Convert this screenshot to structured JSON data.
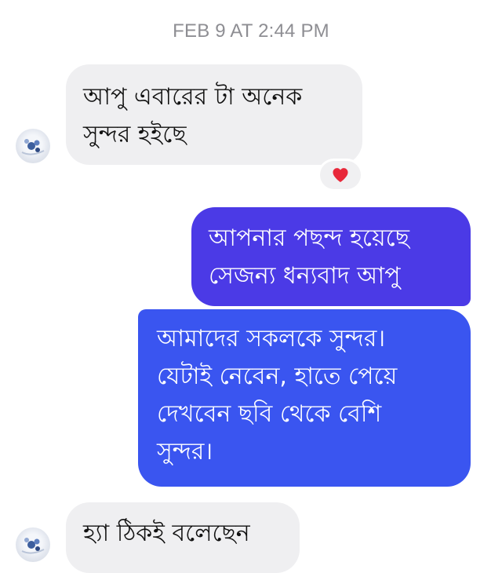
{
  "timestamp": "FEB 9 AT 2:44 PM",
  "messages": [
    {
      "direction": "incoming",
      "lines": [
        "আপু এবারের টা অনেক",
        "সুন্দর হইছে"
      ]
    },
    {
      "direction": "outgoing",
      "lines": [
        "আপনার পছন্দ হয়েছে",
        "সেজন্য ধন্যবাদ আপু"
      ]
    },
    {
      "direction": "outgoing",
      "lines": [
        "আমাদের সকলকে সুন্দর।",
        "যেটাই নেবেন, হাতে পেয়ে",
        "দেখবেন ছবি থেকে বেশি",
        "সুন্দর।"
      ]
    },
    {
      "direction": "incoming",
      "lines": [
        "হ্যা ঠিকই বলেছেন"
      ]
    }
  ],
  "reaction": {
    "icon": "heart-icon",
    "color": "#e8283a"
  },
  "colors": {
    "incoming_bubble": "#efeff1",
    "outgoing_bubble_1": "#4b3ae6",
    "outgoing_bubble_2": "#3a55f0",
    "timestamp_text": "#8e8e93"
  }
}
